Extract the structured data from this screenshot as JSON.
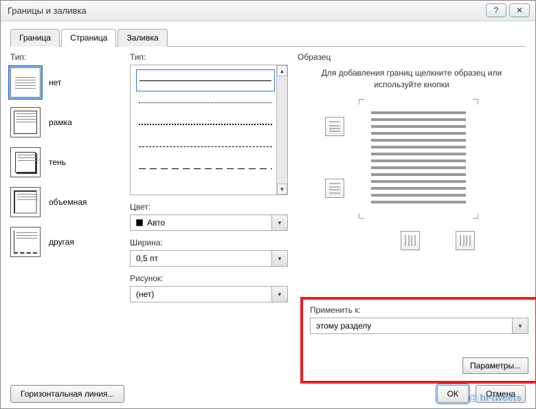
{
  "title": "Границы и заливка",
  "titlebar": {
    "help": "?",
    "close": "✕"
  },
  "tabs": [
    {
      "label": "Граница",
      "active": false
    },
    {
      "label": "Страница",
      "active": true
    },
    {
      "label": "Заливка",
      "active": false
    }
  ],
  "settings": {
    "label": "Тип:",
    "items": [
      {
        "name": "none",
        "label": "нет"
      },
      {
        "name": "box",
        "label": "рамка"
      },
      {
        "name": "shadow",
        "label": "тень"
      },
      {
        "name": "3d",
        "label": "объемная"
      },
      {
        "name": "custom",
        "label": "другая"
      }
    ]
  },
  "style": {
    "label": "Тип:",
    "color_label": "Цвет:",
    "color_value": "Авто",
    "width_label": "Ширина:",
    "width_value": "0,5 пт",
    "art_label": "Рисунок:",
    "art_value": "(нет)"
  },
  "preview": {
    "label": "Образец",
    "hint": "Для добавления границ щелкните образец или используйте кнопки"
  },
  "apply": {
    "label": "Применить к:",
    "value": "этому разделу",
    "params": "Параметры..."
  },
  "buttons": {
    "hline": "Горизонтальная линия...",
    "ok": "ОК",
    "cancel": "Отмена"
  },
  "watermark": "@ hi-tweets"
}
